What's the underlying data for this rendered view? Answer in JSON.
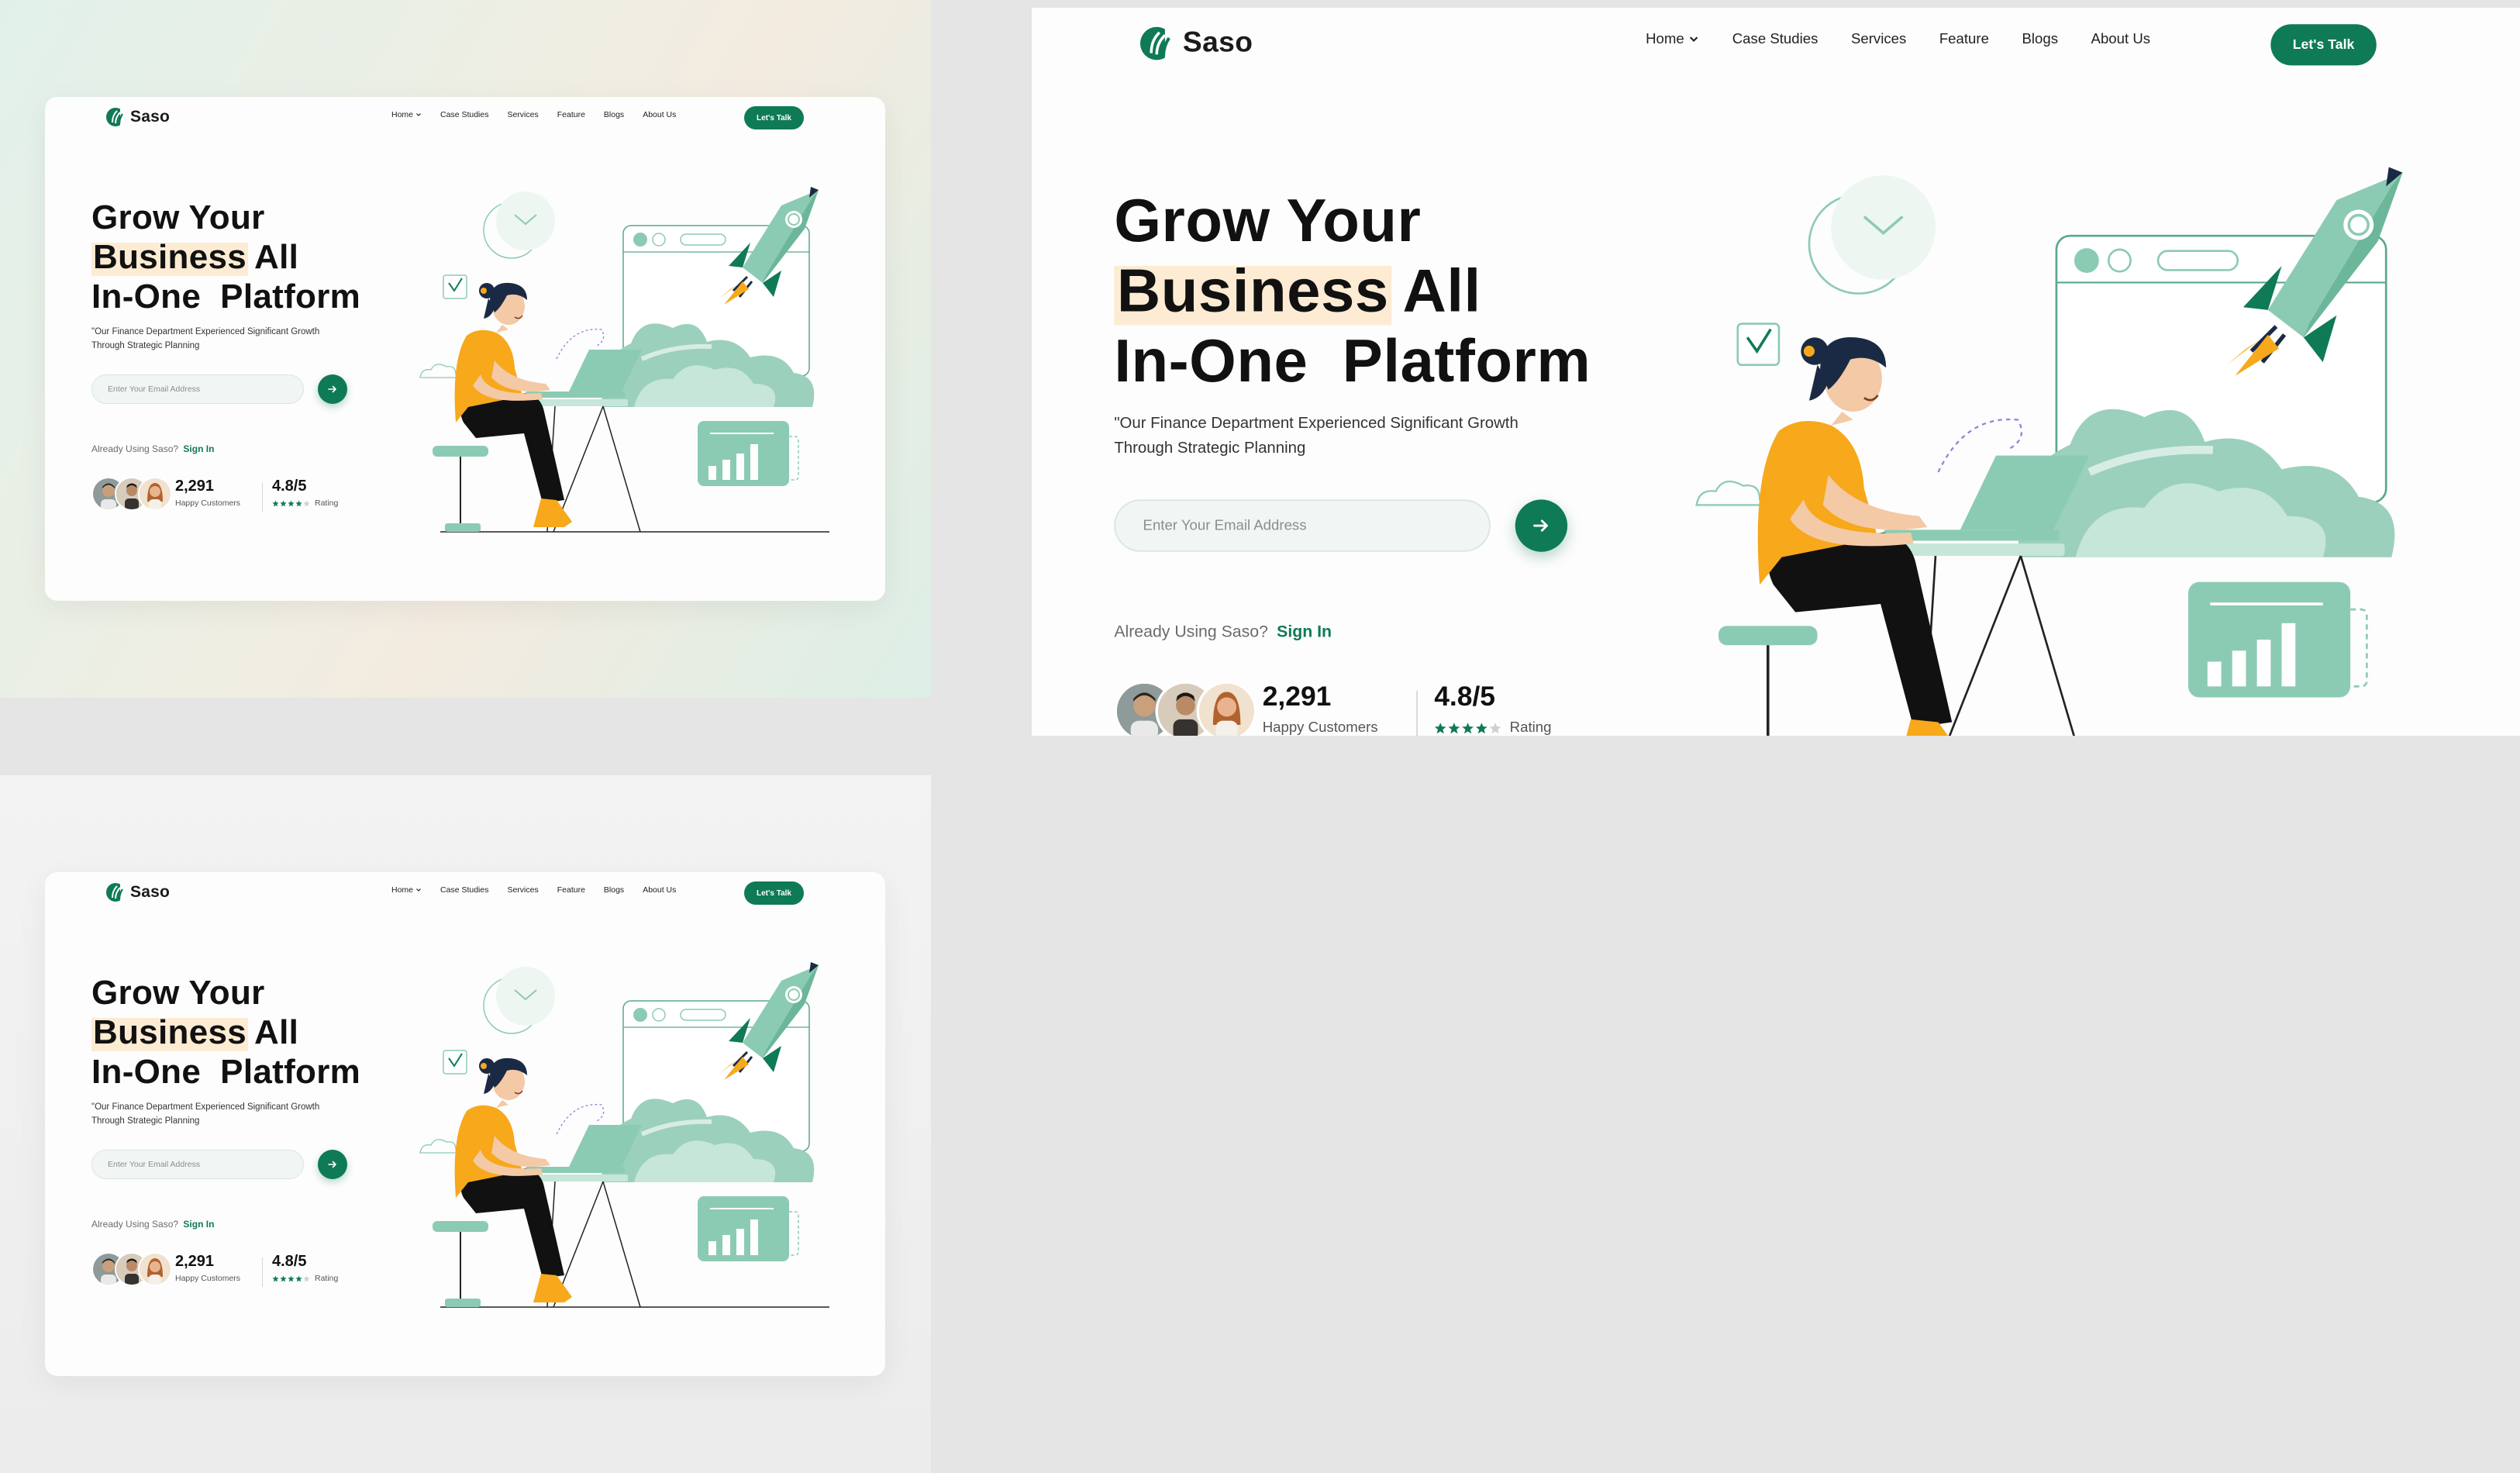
{
  "brand": {
    "name": "Saso"
  },
  "nav": {
    "items": [
      {
        "label": "Home",
        "has_dropdown": true
      },
      {
        "label": "Case Studies"
      },
      {
        "label": "Services"
      },
      {
        "label": "Feature"
      },
      {
        "label": "Blogs"
      },
      {
        "label": "About Us"
      }
    ],
    "cta_label": "Let's Talk"
  },
  "hero": {
    "title_line1": "Grow Your",
    "title_highlight": "Business",
    "title_line2_rest": "All",
    "title_line3": "In-One  Platform",
    "subtitle": "\"Our Finance Department Experienced Significant Growth Through Strategic Planning",
    "email_placeholder": "Enter Your Email Address",
    "signin_prompt": "Already Using Saso?",
    "signin_link": "Sign In"
  },
  "stats": {
    "customers_value": "2,291",
    "customers_label": "Happy Customers",
    "rating_value": "4.8/5",
    "rating_label": "Rating",
    "rating_stars_filled": 4,
    "rating_stars_total": 5
  },
  "colors": {
    "brand_green": "#0f7a56",
    "mint": "#8ccbb3",
    "orange": "#f7a81b",
    "highlight": "#fdecd3"
  },
  "icons": [
    "logo-icon",
    "chevron-down-icon",
    "arrow-right-icon",
    "star-icon",
    "check-icon",
    "rocket-icon",
    "bar-chart-icon",
    "envelope-icon"
  ]
}
